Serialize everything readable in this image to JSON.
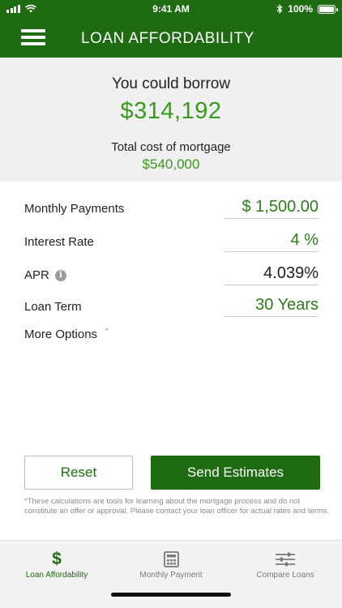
{
  "status_bar": {
    "time": "9:41 AM",
    "battery": "100%"
  },
  "header": {
    "title": "LOAN AFFORDABILITY"
  },
  "summary": {
    "borrow_label": "You could borrow",
    "borrow_amount": "$314,192",
    "cost_label": "Total cost of mortgage",
    "cost_amount": "$540,000"
  },
  "form": {
    "monthly_payments": {
      "label": "Monthly Payments",
      "value": "$ 1,500.00"
    },
    "interest_rate": {
      "label": "Interest Rate",
      "value": "4 %"
    },
    "apr": {
      "label": "APR",
      "value": "4.039%"
    },
    "loan_term": {
      "label": "Loan Term",
      "value": "30 Years"
    },
    "more_options": "More Options"
  },
  "buttons": {
    "reset": "Reset",
    "send": "Send Estimates"
  },
  "disclaimer": "*These calculations are tools for learning about the mortgage process and do not constitute an offer or approval. Please contact your loan officer for actual rates and terms.",
  "tabs": [
    {
      "label": "Loan Affordability",
      "icon": "dollar-icon",
      "active": true
    },
    {
      "label": "Monthly Payment",
      "icon": "calculator-icon",
      "active": false
    },
    {
      "label": "Compare Loans",
      "icon": "sliders-icon",
      "active": false
    }
  ],
  "colors": {
    "brand_green": "#1f6b12",
    "accent_green": "#3a9a1e"
  }
}
